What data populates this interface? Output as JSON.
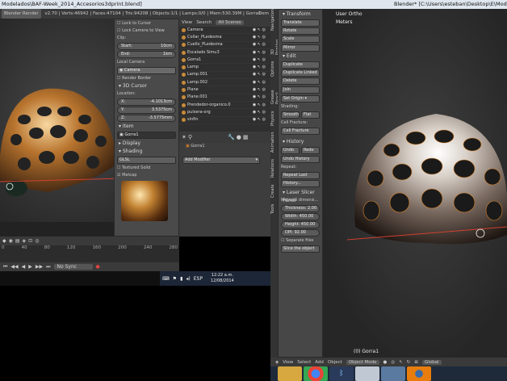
{
  "left_window": {
    "title": "Modelados\\BAF-Week_2014_Accesorios3dprint.blend]",
    "render_engine": "Blender Render",
    "stats": "v2.70 | Verts:46942 | Faces:47104 | Tris:94208 | Objects:1/1 | Lamps:0/0 | Mem:530.39M | Gorra1",
    "header_tail": "Dem"
  },
  "n_panel": {
    "lock_to_cursor": "Lock to Cursor",
    "lock_camera_to_view": "Lock Camera to View",
    "clip_label": "Clip:",
    "clip_start_label": "Start:",
    "clip_start_value": "10cm",
    "clip_end_label": "End:",
    "clip_end_value": "1km",
    "local_camera_label": "Local Camera",
    "camera_field": "Camera",
    "render_border": "Render Border",
    "cursor_header": "3D Cursor",
    "location_label": "Location:",
    "x_label": "X:",
    "x_value": "-4.1013cm",
    "y_label": "Y:",
    "y_value": "3.5375cm",
    "z_label": "Z:",
    "z_value": "-3.5775mm",
    "item_header": "Item",
    "item_name": "Gorra1",
    "display_header": "Display",
    "shading_header": "Shading",
    "shading_mode": "GLSL",
    "textured_solid": "Textured Solid",
    "matcap": "Matcap"
  },
  "outliner": {
    "view_menu": "View",
    "search_menu": "Search",
    "scene_selector": "All Scenes",
    "items": [
      {
        "name": "Camera"
      },
      {
        "name": "Collar_PLedesma"
      },
      {
        "name": "Cuello_PLedesma"
      },
      {
        "name": "Escalado Simu3"
      },
      {
        "name": "Gorra1"
      },
      {
        "name": "Lamp"
      },
      {
        "name": "Lamp.001"
      },
      {
        "name": "Lamp.002"
      },
      {
        "name": "Plane"
      },
      {
        "name": "Plane.001"
      },
      {
        "name": "Prendedor-organico.0"
      },
      {
        "name": "pulsera-org"
      },
      {
        "name": "sinfin"
      }
    ]
  },
  "properties": {
    "object_name": "Gorra1",
    "add_modifier": "Add Modifier"
  },
  "timeline": {
    "ticks": [
      "0",
      "40",
      "80",
      "120",
      "160",
      "200",
      "240",
      "280"
    ],
    "sync_mode": "No Sync"
  },
  "tray": {
    "lang": "ESP",
    "time": "12:22 a.m.",
    "date": "12/08/2014"
  },
  "right_window": {
    "title": "Blender* [C:\\Users\\esteban\\Desktop\\E\\Modela",
    "view_label": "User Ortho",
    "units_label": "Meters",
    "object_label": "(0) Gorra1",
    "view_menu": "View",
    "select_menu": "Select",
    "add_menu": "Add",
    "object_menu": "Object",
    "mode": "Object Mode",
    "pivot": "Global"
  },
  "toolshelf": {
    "tabs": [
      "Tools",
      "Create",
      "Relations",
      "Animation",
      "Physics",
      "Grease Pencil",
      "Options",
      "3D Printing",
      "Navigation"
    ],
    "transform_header": "Transform",
    "translate": "Translate",
    "rotate": "Rotate",
    "scale": "Scale",
    "mirror": "Mirror",
    "edit_header": "Edit",
    "duplicate": "Duplicate",
    "duplicate_linked": "Duplicate Linked",
    "delete": "Delete",
    "join": "Join",
    "set_origin": "Set Origin",
    "shading_label": "Shading:",
    "smooth": "Smooth",
    "flat": "Flat",
    "cell_fracture_label": "Cell Fracture:",
    "cell_fracture": "Cell Fracture",
    "history_header": "History",
    "undo": "Undo",
    "redo": "Redo",
    "undo_history": "Undo History",
    "repeat_label": "Repeat:",
    "repeat_last": "Repeat Last",
    "history": "History...",
    "laser_header": "Laser Slicer Panel",
    "material_dim": "Material dimensi...",
    "thickness": "Thickness: 2.00",
    "width": "Width: 450.00",
    "height": "Height: 450.00",
    "dpi": "DPI:      92.00",
    "separate_files": "Separate files",
    "slice": "Slice the object"
  },
  "colors": {
    "accent_orange": "#d9832a",
    "panel_bg": "#4a4a4a",
    "header_bg": "#3a3a3a"
  }
}
